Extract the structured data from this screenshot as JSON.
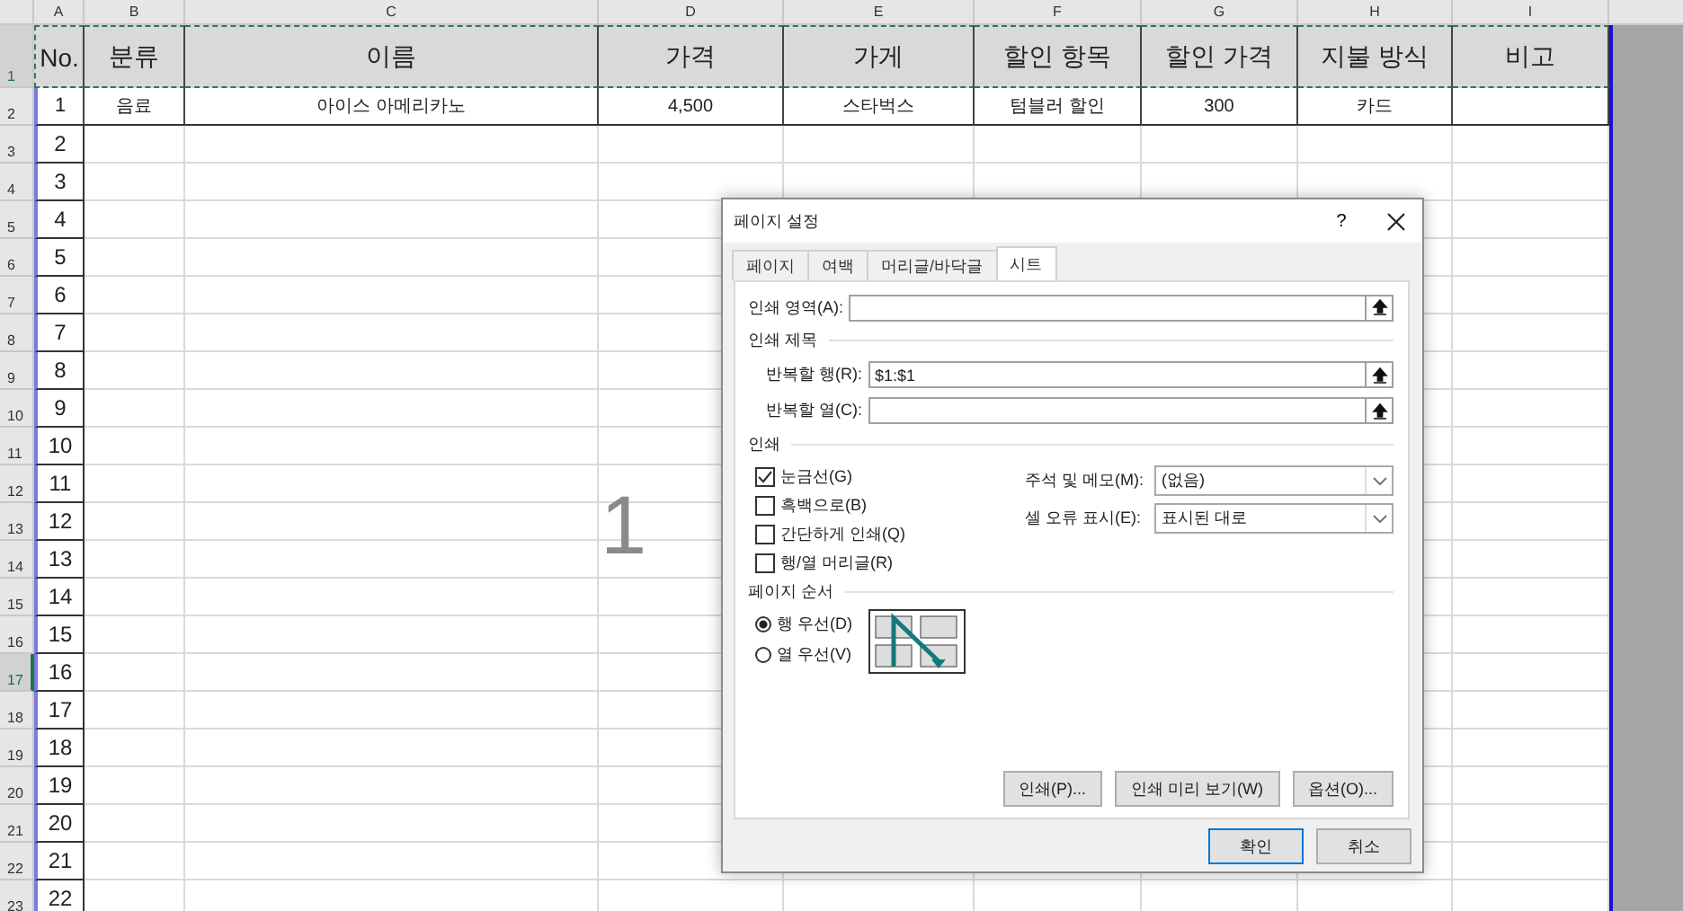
{
  "sheet": {
    "columns": [
      "A",
      "B",
      "C",
      "D",
      "E",
      "F",
      "G",
      "H",
      "I"
    ],
    "rows": [
      {
        "number": "1",
        "kind": "header",
        "selected": false,
        "cells": [
          "No.",
          "분류",
          "이름",
          "가격",
          "가게",
          "할인 항목",
          "할인 가격",
          "지불 방식",
          "비고"
        ]
      },
      {
        "number": "2",
        "kind": "data",
        "selected": false,
        "cells": [
          "1",
          "음료",
          "아이스 아메리카노",
          "4,500",
          "스타벅스",
          "텀블러 할인",
          "300",
          "카드"
        ]
      },
      {
        "number": "3",
        "kind": "index",
        "selected": false,
        "cells": [
          "2"
        ]
      },
      {
        "number": "4",
        "kind": "index",
        "selected": false,
        "cells": [
          "3"
        ]
      },
      {
        "number": "5",
        "kind": "index",
        "selected": false,
        "cells": [
          "4"
        ]
      },
      {
        "number": "6",
        "kind": "index",
        "selected": false,
        "cells": [
          "5"
        ]
      },
      {
        "number": "7",
        "kind": "index",
        "selected": false,
        "cells": [
          "6"
        ]
      },
      {
        "number": "8",
        "kind": "index",
        "selected": false,
        "cells": [
          "7"
        ]
      },
      {
        "number": "9",
        "kind": "index",
        "selected": false,
        "cells": [
          "8"
        ]
      },
      {
        "number": "10",
        "kind": "index",
        "selected": false,
        "cells": [
          "9"
        ]
      },
      {
        "number": "11",
        "kind": "index",
        "selected": false,
        "cells": [
          "10"
        ]
      },
      {
        "number": "12",
        "kind": "index",
        "selected": false,
        "cells": [
          "11"
        ]
      },
      {
        "number": "13",
        "kind": "index",
        "selected": false,
        "cells": [
          "12"
        ]
      },
      {
        "number": "14",
        "kind": "index",
        "selected": false,
        "cells": [
          "13"
        ]
      },
      {
        "number": "15",
        "kind": "index",
        "selected": false,
        "cells": [
          "14"
        ]
      },
      {
        "number": "16",
        "kind": "index",
        "selected": false,
        "cells": [
          "15"
        ]
      },
      {
        "number": "17",
        "kind": "index",
        "selected": true,
        "cells": [
          "16"
        ]
      },
      {
        "number": "18",
        "kind": "index",
        "selected": false,
        "cells": [
          "17"
        ]
      },
      {
        "number": "19",
        "kind": "index",
        "selected": false,
        "cells": [
          "18"
        ]
      },
      {
        "number": "20",
        "kind": "index",
        "selected": false,
        "cells": [
          "19"
        ]
      },
      {
        "number": "21",
        "kind": "index",
        "selected": false,
        "cells": [
          "20"
        ]
      },
      {
        "number": "22",
        "kind": "index",
        "selected": false,
        "cells": [
          "21"
        ]
      },
      {
        "number": "23",
        "kind": "index",
        "selected": false,
        "cells": [
          "22"
        ]
      }
    ],
    "page_watermark": "1"
  },
  "dialog": {
    "title": "페이지 설정",
    "help": "?",
    "tabs": [
      {
        "label": "페이지",
        "selected": false
      },
      {
        "label": "여백",
        "selected": false
      },
      {
        "label": "머리글/바닥글",
        "selected": false
      },
      {
        "label": "시트",
        "selected": true
      }
    ],
    "print_area": {
      "label": "인쇄 영역(A):"
    },
    "print_titles": {
      "title": "인쇄 제목",
      "fields": [
        {
          "label": "반복할 행(R):",
          "value": "$1:$1"
        },
        {
          "label": "반복할 열(C):"
        }
      ]
    },
    "print": {
      "title": "인쇄",
      "checkboxes": [
        {
          "label": "눈금선(G)",
          "checked": true
        },
        {
          "label": "흑백으로(B)",
          "checked": false
        },
        {
          "label": "간단하게 인쇄(Q)",
          "checked": false
        },
        {
          "label": "행/열 머리글(R)",
          "checked": false
        }
      ],
      "dropdowns": [
        {
          "label": "주석 및 메모(M):",
          "value": "(없음)"
        },
        {
          "label": "셀 오류 표시(E):",
          "value": "표시된 대로"
        }
      ]
    },
    "page_order": {
      "title": "페이지 순서",
      "options": [
        {
          "label": "행 우선(D)",
          "selected": true
        },
        {
          "label": "열 우선(V)",
          "selected": false
        }
      ]
    },
    "actions": [
      "인쇄(P)...",
      "인쇄 미리 보기(W)",
      "옵션(O)..."
    ],
    "buttons": [
      {
        "label": "확인",
        "kind": "default"
      },
      {
        "label": "취소",
        "kind": "normal"
      }
    ]
  }
}
